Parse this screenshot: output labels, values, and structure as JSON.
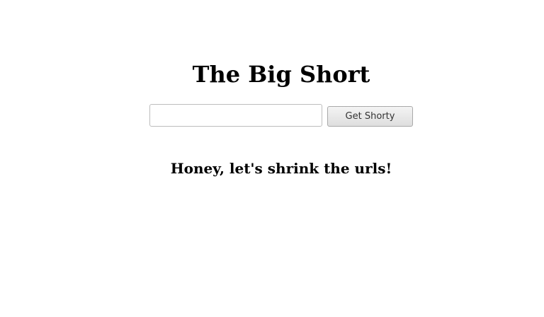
{
  "title": "The Big Short",
  "url_input": {
    "value": "",
    "placeholder": ""
  },
  "submit_label": "Get Shorty",
  "tagline": "Honey, let's shrink the urls!"
}
